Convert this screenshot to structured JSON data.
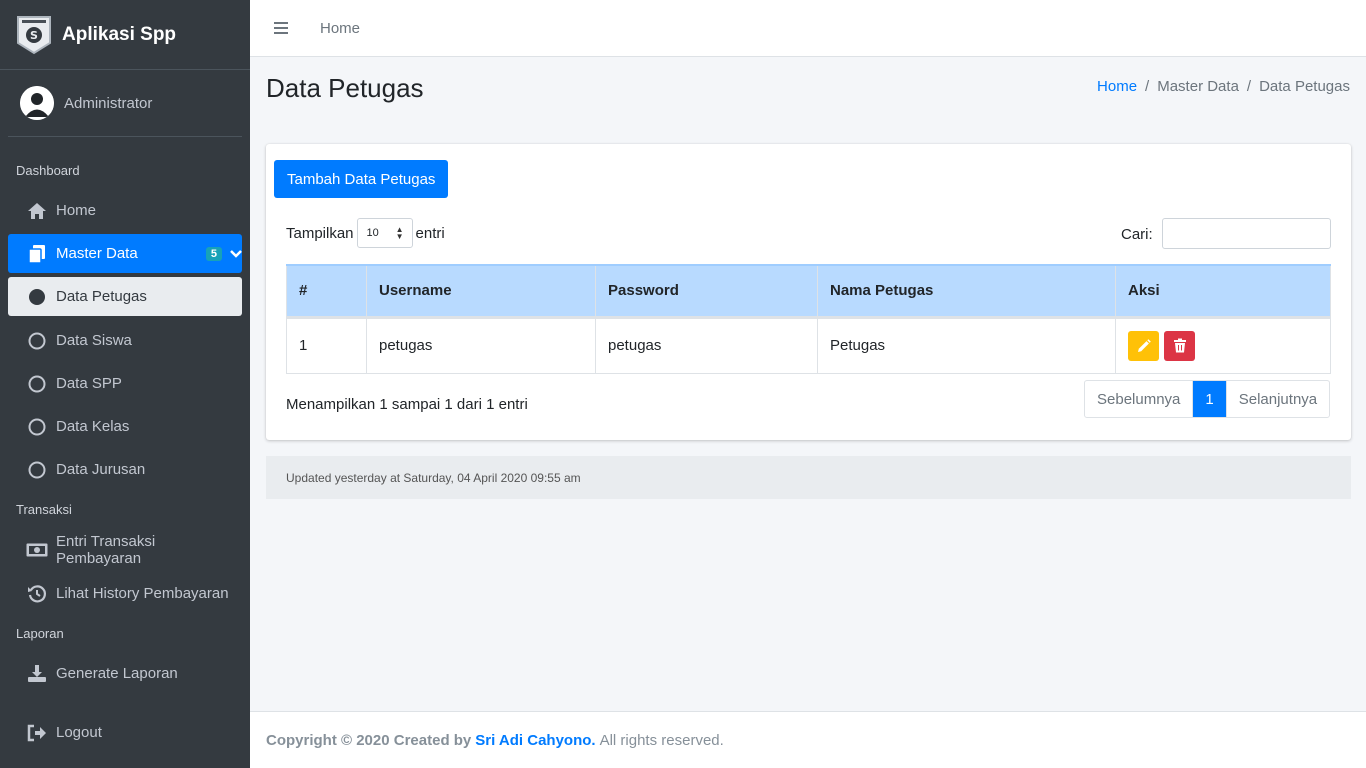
{
  "brand": {
    "title": "Aplikasi Spp"
  },
  "user": {
    "name": "Administrator"
  },
  "sidebar": {
    "dashboard_header": "Dashboard",
    "home": "Home",
    "master_data": "Master Data",
    "master_badge": "5",
    "submenu": [
      "Data Petugas",
      "Data Siswa",
      "Data SPP",
      "Data Kelas",
      "Data Jurusan"
    ],
    "transaksi_header": "Transaksi",
    "entri_transaksi": "Entri Transaksi Pembayaran",
    "lihat_history": "Lihat History Pembayaran",
    "laporan_header": "Laporan",
    "generate_laporan": "Generate Laporan",
    "logout": "Logout"
  },
  "topbar": {
    "home": "Home"
  },
  "page": {
    "title": "Data Petugas",
    "breadcrumb": [
      "Home",
      "/",
      "Master Data",
      "/",
      "Data Petugas"
    ]
  },
  "card": {
    "add_button": "Tambah Data Petugas",
    "show_prefix": "Tampilkan",
    "show_value": "10",
    "show_suffix": "entri",
    "search_label": "Cari:",
    "search_value": ""
  },
  "table": {
    "headers": [
      "#",
      "Username",
      "Password",
      "Nama Petugas",
      "Aksi"
    ],
    "rows": [
      [
        "1",
        "petugas",
        "petugas",
        "Petugas"
      ]
    ]
  },
  "pagination": {
    "info": "Menampilkan 1 sampai 1 dari 1 entri",
    "prev": "Sebelumnya",
    "current": "1",
    "next": "Selanjutnya"
  },
  "updated": "Updated yesterday at Saturday, 04 April 2020 09:55 am",
  "footer": {
    "prefix": "Copyright © 2020 Created by",
    "author": "Sri Adi Cahyono.",
    "suffix": "All rights reserved."
  },
  "colors": {
    "sidebar_bg": "#343a40",
    "primary": "#007bff",
    "warning": "#ffc107",
    "danger": "#dc3545",
    "table_header": "#b8daff"
  }
}
